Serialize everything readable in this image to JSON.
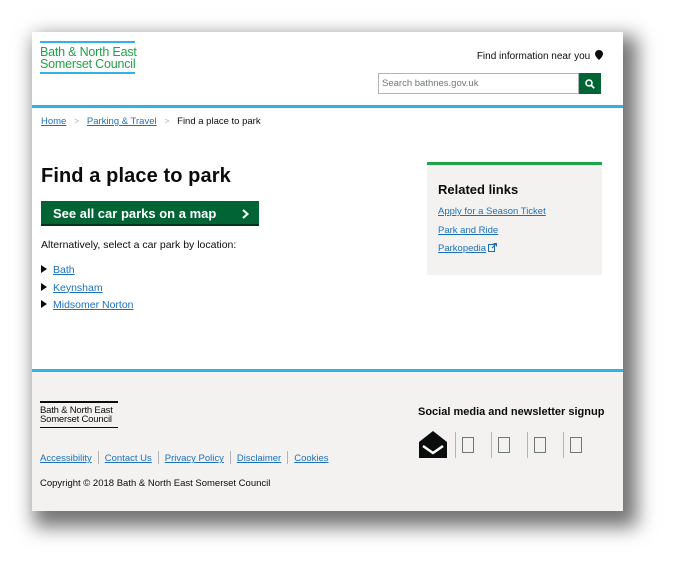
{
  "header": {
    "logo_line1": "Bath & North East",
    "logo_line2": "Somerset Council",
    "near_label": "Find information near you",
    "search_placeholder": "Search bathnes.gov.uk"
  },
  "breadcrumb": {
    "items": [
      {
        "label": "Home"
      },
      {
        "label": "Parking & Travel"
      }
    ],
    "current": "Find a place to park"
  },
  "main": {
    "title": "Find a place to park",
    "map_button": "See all car parks on a map",
    "alt_text": "Alternatively, select a car park by location:",
    "locations": [
      "Bath",
      "Keynsham",
      "Midsomer Norton"
    ]
  },
  "related": {
    "title": "Related links",
    "links": [
      "Apply for a Season Ticket",
      "Park and Ride",
      "Parkopedia"
    ]
  },
  "footer": {
    "logo_line1": "Bath & North East",
    "logo_line2": "Somerset Council",
    "links": [
      "Accessibility",
      "Contact Us",
      "Privacy Policy",
      "Disclaimer",
      "Cookies"
    ],
    "copyright": "Copyright © 2018 Bath & North East Somerset Council",
    "social_title": "Social media and newsletter signup",
    "social_icons": [
      "newsletter-envelope-icon",
      "social-icon-1",
      "social-icon-2",
      "social-icon-3",
      "social-icon-4"
    ]
  },
  "colors": {
    "brand_green": "#006435",
    "logo_green": "#1fa34a",
    "accent_blue": "#31b2e6",
    "link_blue": "#1d70b8",
    "footer_bg": "#f3f2f1"
  }
}
